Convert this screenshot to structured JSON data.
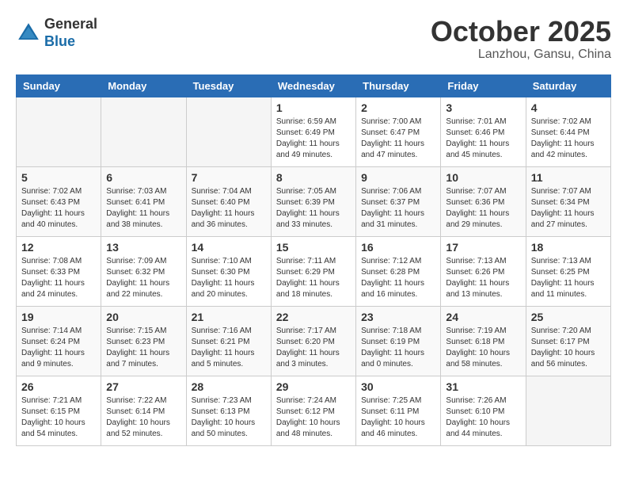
{
  "header": {
    "logo_general": "General",
    "logo_blue": "Blue",
    "month_title": "October 2025",
    "location": "Lanzhou, Gansu, China"
  },
  "weekdays": [
    "Sunday",
    "Monday",
    "Tuesday",
    "Wednesday",
    "Thursday",
    "Friday",
    "Saturday"
  ],
  "weeks": [
    [
      {
        "day": "",
        "info": ""
      },
      {
        "day": "",
        "info": ""
      },
      {
        "day": "",
        "info": ""
      },
      {
        "day": "1",
        "info": "Sunrise: 6:59 AM\nSunset: 6:49 PM\nDaylight: 11 hours\nand 49 minutes."
      },
      {
        "day": "2",
        "info": "Sunrise: 7:00 AM\nSunset: 6:47 PM\nDaylight: 11 hours\nand 47 minutes."
      },
      {
        "day": "3",
        "info": "Sunrise: 7:01 AM\nSunset: 6:46 PM\nDaylight: 11 hours\nand 45 minutes."
      },
      {
        "day": "4",
        "info": "Sunrise: 7:02 AM\nSunset: 6:44 PM\nDaylight: 11 hours\nand 42 minutes."
      }
    ],
    [
      {
        "day": "5",
        "info": "Sunrise: 7:02 AM\nSunset: 6:43 PM\nDaylight: 11 hours\nand 40 minutes."
      },
      {
        "day": "6",
        "info": "Sunrise: 7:03 AM\nSunset: 6:41 PM\nDaylight: 11 hours\nand 38 minutes."
      },
      {
        "day": "7",
        "info": "Sunrise: 7:04 AM\nSunset: 6:40 PM\nDaylight: 11 hours\nand 36 minutes."
      },
      {
        "day": "8",
        "info": "Sunrise: 7:05 AM\nSunset: 6:39 PM\nDaylight: 11 hours\nand 33 minutes."
      },
      {
        "day": "9",
        "info": "Sunrise: 7:06 AM\nSunset: 6:37 PM\nDaylight: 11 hours\nand 31 minutes."
      },
      {
        "day": "10",
        "info": "Sunrise: 7:07 AM\nSunset: 6:36 PM\nDaylight: 11 hours\nand 29 minutes."
      },
      {
        "day": "11",
        "info": "Sunrise: 7:07 AM\nSunset: 6:34 PM\nDaylight: 11 hours\nand 27 minutes."
      }
    ],
    [
      {
        "day": "12",
        "info": "Sunrise: 7:08 AM\nSunset: 6:33 PM\nDaylight: 11 hours\nand 24 minutes."
      },
      {
        "day": "13",
        "info": "Sunrise: 7:09 AM\nSunset: 6:32 PM\nDaylight: 11 hours\nand 22 minutes."
      },
      {
        "day": "14",
        "info": "Sunrise: 7:10 AM\nSunset: 6:30 PM\nDaylight: 11 hours\nand 20 minutes."
      },
      {
        "day": "15",
        "info": "Sunrise: 7:11 AM\nSunset: 6:29 PM\nDaylight: 11 hours\nand 18 minutes."
      },
      {
        "day": "16",
        "info": "Sunrise: 7:12 AM\nSunset: 6:28 PM\nDaylight: 11 hours\nand 16 minutes."
      },
      {
        "day": "17",
        "info": "Sunrise: 7:13 AM\nSunset: 6:26 PM\nDaylight: 11 hours\nand 13 minutes."
      },
      {
        "day": "18",
        "info": "Sunrise: 7:13 AM\nSunset: 6:25 PM\nDaylight: 11 hours\nand 11 minutes."
      }
    ],
    [
      {
        "day": "19",
        "info": "Sunrise: 7:14 AM\nSunset: 6:24 PM\nDaylight: 11 hours\nand 9 minutes."
      },
      {
        "day": "20",
        "info": "Sunrise: 7:15 AM\nSunset: 6:23 PM\nDaylight: 11 hours\nand 7 minutes."
      },
      {
        "day": "21",
        "info": "Sunrise: 7:16 AM\nSunset: 6:21 PM\nDaylight: 11 hours\nand 5 minutes."
      },
      {
        "day": "22",
        "info": "Sunrise: 7:17 AM\nSunset: 6:20 PM\nDaylight: 11 hours\nand 3 minutes."
      },
      {
        "day": "23",
        "info": "Sunrise: 7:18 AM\nSunset: 6:19 PM\nDaylight: 11 hours\nand 0 minutes."
      },
      {
        "day": "24",
        "info": "Sunrise: 7:19 AM\nSunset: 6:18 PM\nDaylight: 10 hours\nand 58 minutes."
      },
      {
        "day": "25",
        "info": "Sunrise: 7:20 AM\nSunset: 6:17 PM\nDaylight: 10 hours\nand 56 minutes."
      }
    ],
    [
      {
        "day": "26",
        "info": "Sunrise: 7:21 AM\nSunset: 6:15 PM\nDaylight: 10 hours\nand 54 minutes."
      },
      {
        "day": "27",
        "info": "Sunrise: 7:22 AM\nSunset: 6:14 PM\nDaylight: 10 hours\nand 52 minutes."
      },
      {
        "day": "28",
        "info": "Sunrise: 7:23 AM\nSunset: 6:13 PM\nDaylight: 10 hours\nand 50 minutes."
      },
      {
        "day": "29",
        "info": "Sunrise: 7:24 AM\nSunset: 6:12 PM\nDaylight: 10 hours\nand 48 minutes."
      },
      {
        "day": "30",
        "info": "Sunrise: 7:25 AM\nSunset: 6:11 PM\nDaylight: 10 hours\nand 46 minutes."
      },
      {
        "day": "31",
        "info": "Sunrise: 7:26 AM\nSunset: 6:10 PM\nDaylight: 10 hours\nand 44 minutes."
      },
      {
        "day": "",
        "info": ""
      }
    ]
  ]
}
